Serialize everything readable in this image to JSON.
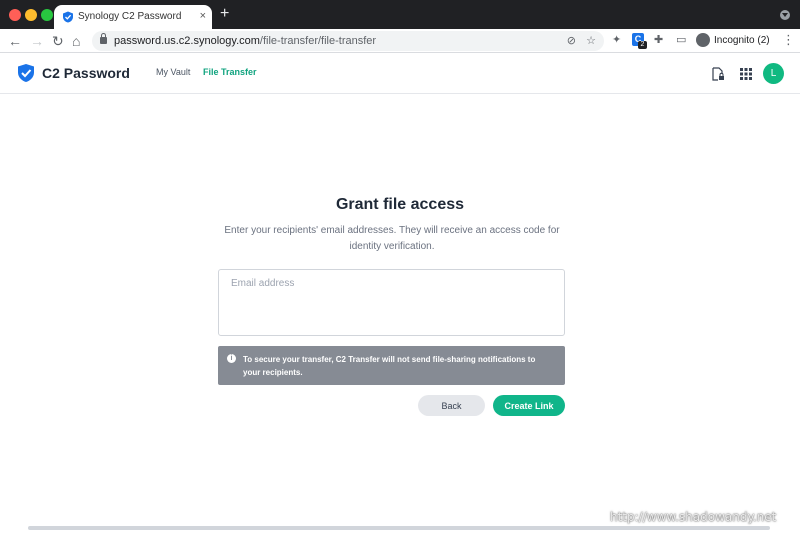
{
  "browser": {
    "tab_title": "Synology C2 Password",
    "tab_close": "×",
    "new_tab": "+",
    "url_host": "password.us.c2.synology.com",
    "url_path": "/file-transfer/file-transfer",
    "extension_label": "C",
    "extension_badge": "2",
    "incognito_label": "Incognito (2)"
  },
  "header": {
    "brand": "C2 Password",
    "nav": [
      {
        "label": "My Vault",
        "active": false
      },
      {
        "label": "File Transfer",
        "active": true
      }
    ],
    "avatar_initial": "L",
    "accent_color": "#10b981"
  },
  "main": {
    "title": "Grant file access",
    "description": "Enter your recipients' email addresses. They will receive an access code for identity verification.",
    "email_placeholder": "Email address",
    "email_value": "",
    "notice_icon": "i",
    "notice": "To secure your transfer, C2 Transfer will not send file-sharing notifications to your recipients.",
    "back_label": "Back",
    "create_label": "Create Link"
  },
  "watermark": "http://www.shadowandy.net"
}
